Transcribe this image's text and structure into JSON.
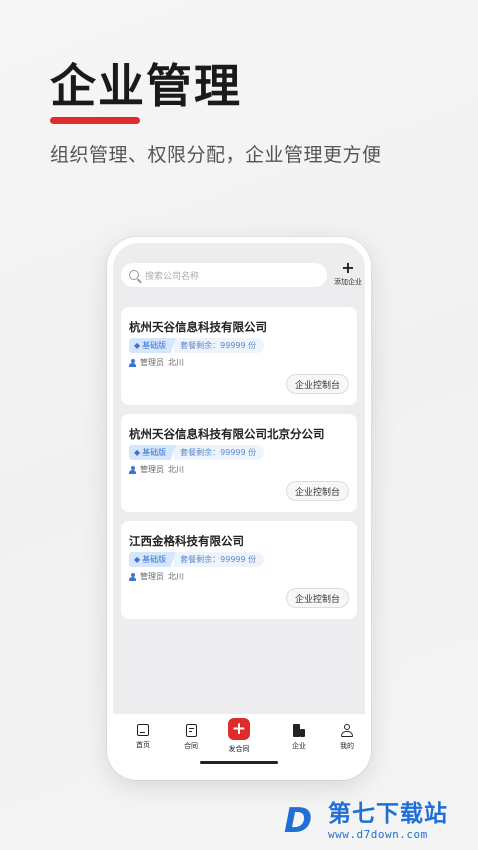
{
  "hero": {
    "title": "企业管理",
    "subtitle": "组织管理、权限分配，企业管理更方便"
  },
  "search": {
    "placeholder": "搜索公司名称"
  },
  "header": {
    "add_company_label": "添加企业"
  },
  "companies": [
    {
      "name": "杭州天谷信息科技有限公司",
      "plan": "基础版",
      "quota": "套餐剩余：99999 份",
      "admin_label": "管理员",
      "admin_name": "北川",
      "console_label": "企业控制台"
    },
    {
      "name": "杭州天谷信息科技有限公司北京分公司",
      "plan": "基础版",
      "quota": "套餐剩余：99999 份",
      "admin_label": "管理员",
      "admin_name": "北川",
      "console_label": "企业控制台"
    },
    {
      "name": "江西金格科技有限公司",
      "plan": "基础版",
      "quota": "套餐剩余：99999 份",
      "admin_label": "管理员",
      "admin_name": "北川",
      "console_label": "企业控制台"
    }
  ],
  "tabbar": [
    {
      "label": "首页",
      "icon": "home-icon"
    },
    {
      "label": "合同",
      "icon": "contract-icon"
    },
    {
      "label": "发合同",
      "icon": "add-contract-icon"
    },
    {
      "label": "企业",
      "icon": "enterprise-icon"
    },
    {
      "label": "我的",
      "icon": "profile-icon"
    }
  ],
  "watermark": {
    "logo": "D",
    "title": "第七下载站",
    "url": "www.d7down.com"
  },
  "colors": {
    "accent": "#e02b2b",
    "badge_blue": "#3a74d4",
    "watermark_blue": "#1f6fd6"
  }
}
